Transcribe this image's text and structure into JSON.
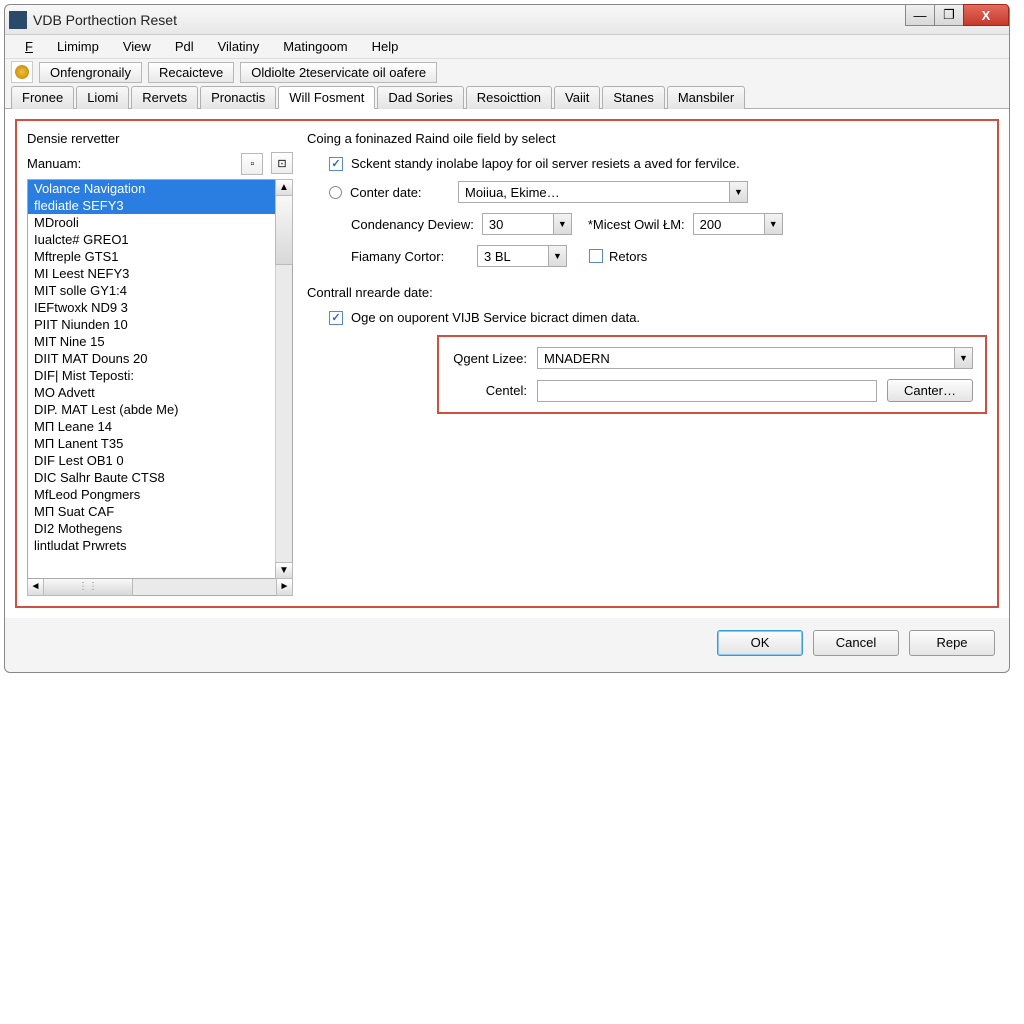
{
  "window": {
    "title": "VDB Porthection Reset"
  },
  "menu": {
    "file": "File",
    "limimp": "Limimp",
    "view": "View",
    "pdl": "Pdl",
    "vilatiny": "Vilatiny",
    "matingoom": "Matingoom",
    "help": "Help"
  },
  "toolbar": {
    "onfengronaily": "Onfengronaily",
    "recaicteve": "Recaicteve",
    "oldiolte": "Oldiolte 2teservicate oil oafere"
  },
  "tabs": {
    "fronee": "Fronee",
    "liomi": "Liomi",
    "rervets": "Rervets",
    "pronactis": "Pronactis",
    "will_fosment": "Will Fosment",
    "dad_sories": "Dad Sories",
    "resoicttion": "Resoicttion",
    "vaiit": "Vaiit",
    "stanes": "Stanes",
    "mansbiler": "Mansbiler"
  },
  "left": {
    "group": "Densie rervetter",
    "manuam": "Manuam:",
    "items": [
      "Volance Navigation",
      "flediatle SEFY3",
      "MDrooli",
      "Iualcte# GREO1",
      "Mftreple GTS1",
      "MI Leest NEFY3",
      "MIT solle GY1:4",
      "IEFtwoxk ND9 3",
      "PIIT Niunden 10",
      "MIT Nine 15",
      "DIIT MAT Douns 20",
      "DIF| Mist Teposti:",
      "MO Advett",
      "DIP. MAT Lest (abde Me)",
      "MП Leane 14",
      "MП Lanent T35",
      "DIF Lest OB1 0",
      "DIC Salhr Baute CTS8",
      "MfLeod Pongmers",
      "MП Suat CAF",
      "DI2 Mothegens",
      "lintludat Prwrets"
    ]
  },
  "right": {
    "section1_title": "Coing a foninazed Raind oile field by select",
    "chk1": "Sckent standy inolabe lapoy for oil server resiets a aved for fervilce.",
    "conter_date": "Conter date:",
    "conter_date_val": "Moiiua, Ekime…",
    "condenancy": "Condenancy Deview:",
    "condenancy_val": "30",
    "micest": "*Micest Owil ŁM:",
    "micest_val": "200",
    "fiamany": "Fiamany Cortor:",
    "fiamany_val": "3 BL",
    "retots": "Retors",
    "section2_title": "Contrall nrearde date:",
    "chk2": "Oge on ouporent VIJB Service bicract dimen data.",
    "qgent": "Qgent Lizee:",
    "qgent_val": "MNADERN",
    "centel": "Centel:",
    "centel_val": "",
    "canter_btn": "Canter…"
  },
  "buttons": {
    "ok": "OK",
    "cancel": "Cancel",
    "repe": "Repe"
  }
}
